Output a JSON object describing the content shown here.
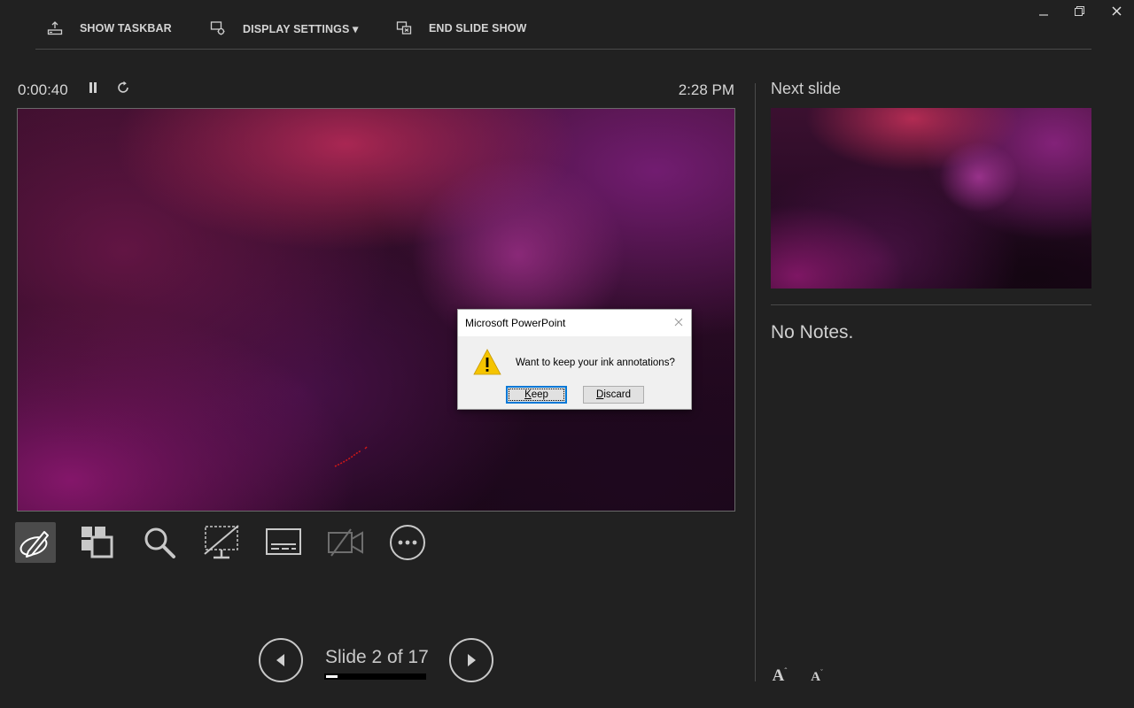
{
  "toolbar": {
    "show_taskbar": "SHOW TASKBAR",
    "display_settings": "DISPLAY SETTINGS ▾",
    "end_slide_show": "END SLIDE SHOW"
  },
  "window_controls": [
    "minimize-icon",
    "restore-icon",
    "close-icon"
  ],
  "presenter": {
    "elapsed_time": "0:00:40",
    "clock": "2:28 PM",
    "slide_counter": "Slide 2 of 17",
    "progress_fraction": 0.118
  },
  "dialog": {
    "title": "Microsoft PowerPoint",
    "message": "Want to keep your ink annotations?",
    "keep_label_underlined": "K",
    "keep_label_rest": "eep",
    "discard_label_underlined": "D",
    "discard_label_rest": "iscard"
  },
  "tools": [
    "pen-tool-icon",
    "see-all-slides-icon",
    "zoom-icon",
    "black-screen-icon",
    "subtitles-icon",
    "camera-off-icon",
    "more-options-icon"
  ],
  "next_pane": {
    "label": "Next slide",
    "notes": "No Notes."
  },
  "font_controls": {
    "increase": "A",
    "decrease": "A"
  },
  "colors": {
    "background": "#212121",
    "text": "#d0d0d0",
    "dialog_focus": "#0078d7",
    "warning": "#f5c400"
  }
}
